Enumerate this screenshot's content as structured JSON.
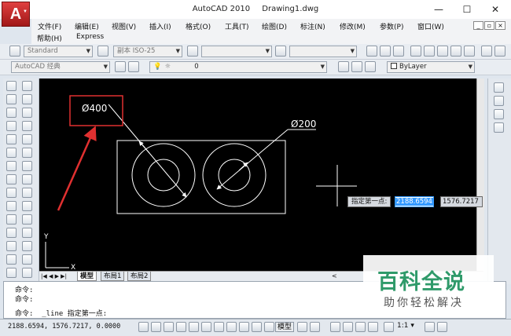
{
  "window": {
    "app_name": "AutoCAD 2010",
    "doc_name": "Drawing1.dwg",
    "logo_letter": "A",
    "minimize": "—",
    "maximize": "☐",
    "close": "✕"
  },
  "menubar": {
    "items": [
      "文件(F)",
      "编辑(E)",
      "视图(V)",
      "插入(I)",
      "格式(O)",
      "工具(T)",
      "绘图(D)",
      "标注(N)",
      "修改(M)",
      "参数(P)",
      "窗口(W)"
    ],
    "items2": [
      "帮助(H)",
      "Express"
    ],
    "mdi": [
      "_",
      "▫",
      "×"
    ]
  },
  "toolbar1": {
    "text_style": "Standard",
    "dim_style": "副本 ISO-25"
  },
  "toolbar2": {
    "workspace": "AutoCAD 经典",
    "layer": "0",
    "color": "ByLayer"
  },
  "drawing": {
    "dim_large": "Ø400",
    "dim_small": "Ø200",
    "axis_x": "X",
    "axis_y": "Y"
  },
  "dynamic_input": {
    "prompt": "指定第一点:",
    "x_value": "2188.6594",
    "y_value": "1576.7217"
  },
  "layout_tabs": {
    "nav": "|◀ ◀ ▶ ▶|",
    "tabs": [
      "模型",
      "布局1",
      "布局2"
    ]
  },
  "command": {
    "lines": [
      "命令:",
      "命令:"
    ],
    "current": "命令:  _line 指定第一点:"
  },
  "status": {
    "coords": "2188.6594, 1576.7217, 0.0000",
    "model": "模型",
    "scale": "1:1 ▾"
  },
  "watermark": {
    "main": "百科全说",
    "sub": "助你轻松解决"
  },
  "colors": {
    "canvas": "#000000",
    "annotation_red": "#e03030",
    "entity": "#ffffff",
    "watermark_green": "#2f9a6a"
  }
}
